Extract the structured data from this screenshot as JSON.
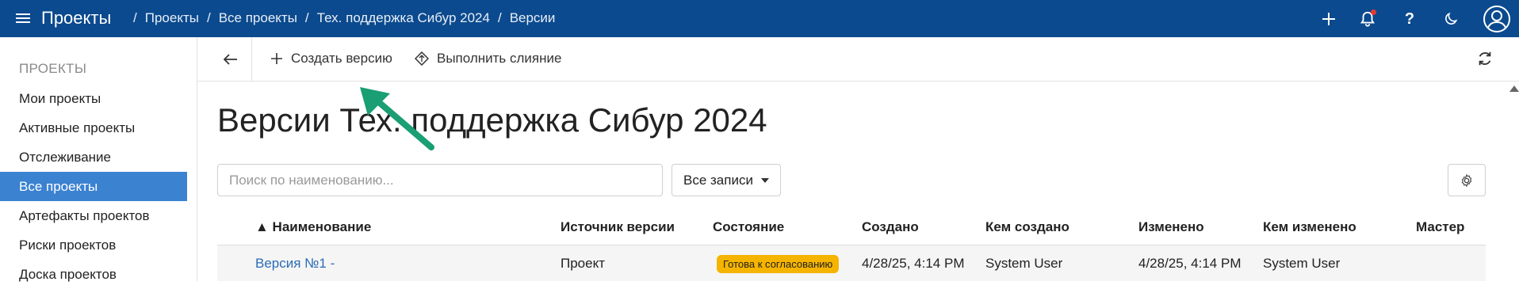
{
  "header": {
    "app_title": "Проекты",
    "breadcrumb": [
      "Проекты",
      "Все проекты",
      "Тех. поддержка Сибур 2024",
      "Версии"
    ],
    "help_label": "?"
  },
  "sidebar": {
    "header": "ПРОЕКТЫ",
    "items": [
      {
        "label": "Мои проекты"
      },
      {
        "label": "Активные проекты"
      },
      {
        "label": "Отслеживание"
      },
      {
        "label": "Все проекты"
      },
      {
        "label": "Артефакты проектов"
      },
      {
        "label": "Риски проектов"
      },
      {
        "label": "Доска проектов"
      }
    ]
  },
  "toolbar": {
    "create_label": "Создать версию",
    "merge_label": "Выполнить слияние"
  },
  "main": {
    "title": "Версии Тех. поддержка Сибур 2024",
    "search_placeholder": "Поиск по наименованию...",
    "filter_label": "Все записи"
  },
  "table": {
    "columns": [
      "▲ Наименование",
      "Источник версии",
      "Состояние",
      "Создано",
      "Кем создано",
      "Изменено",
      "Кем изменено",
      "Мастер"
    ],
    "rows": [
      {
        "name": "Версия №1 -",
        "source": "Проект",
        "status": "Готова к согласованию",
        "created": "4/28/25, 4:14 PM",
        "created_by": "System User",
        "modified": "4/28/25, 4:14 PM",
        "modified_by": "System User",
        "master": ""
      }
    ]
  },
  "colors": {
    "topbar": "#0b4a8e",
    "active_item": "#3b82d1",
    "link": "#2a6cb5",
    "status_badge": "#f5b400",
    "annotation_arrow": "#1a9e73"
  }
}
